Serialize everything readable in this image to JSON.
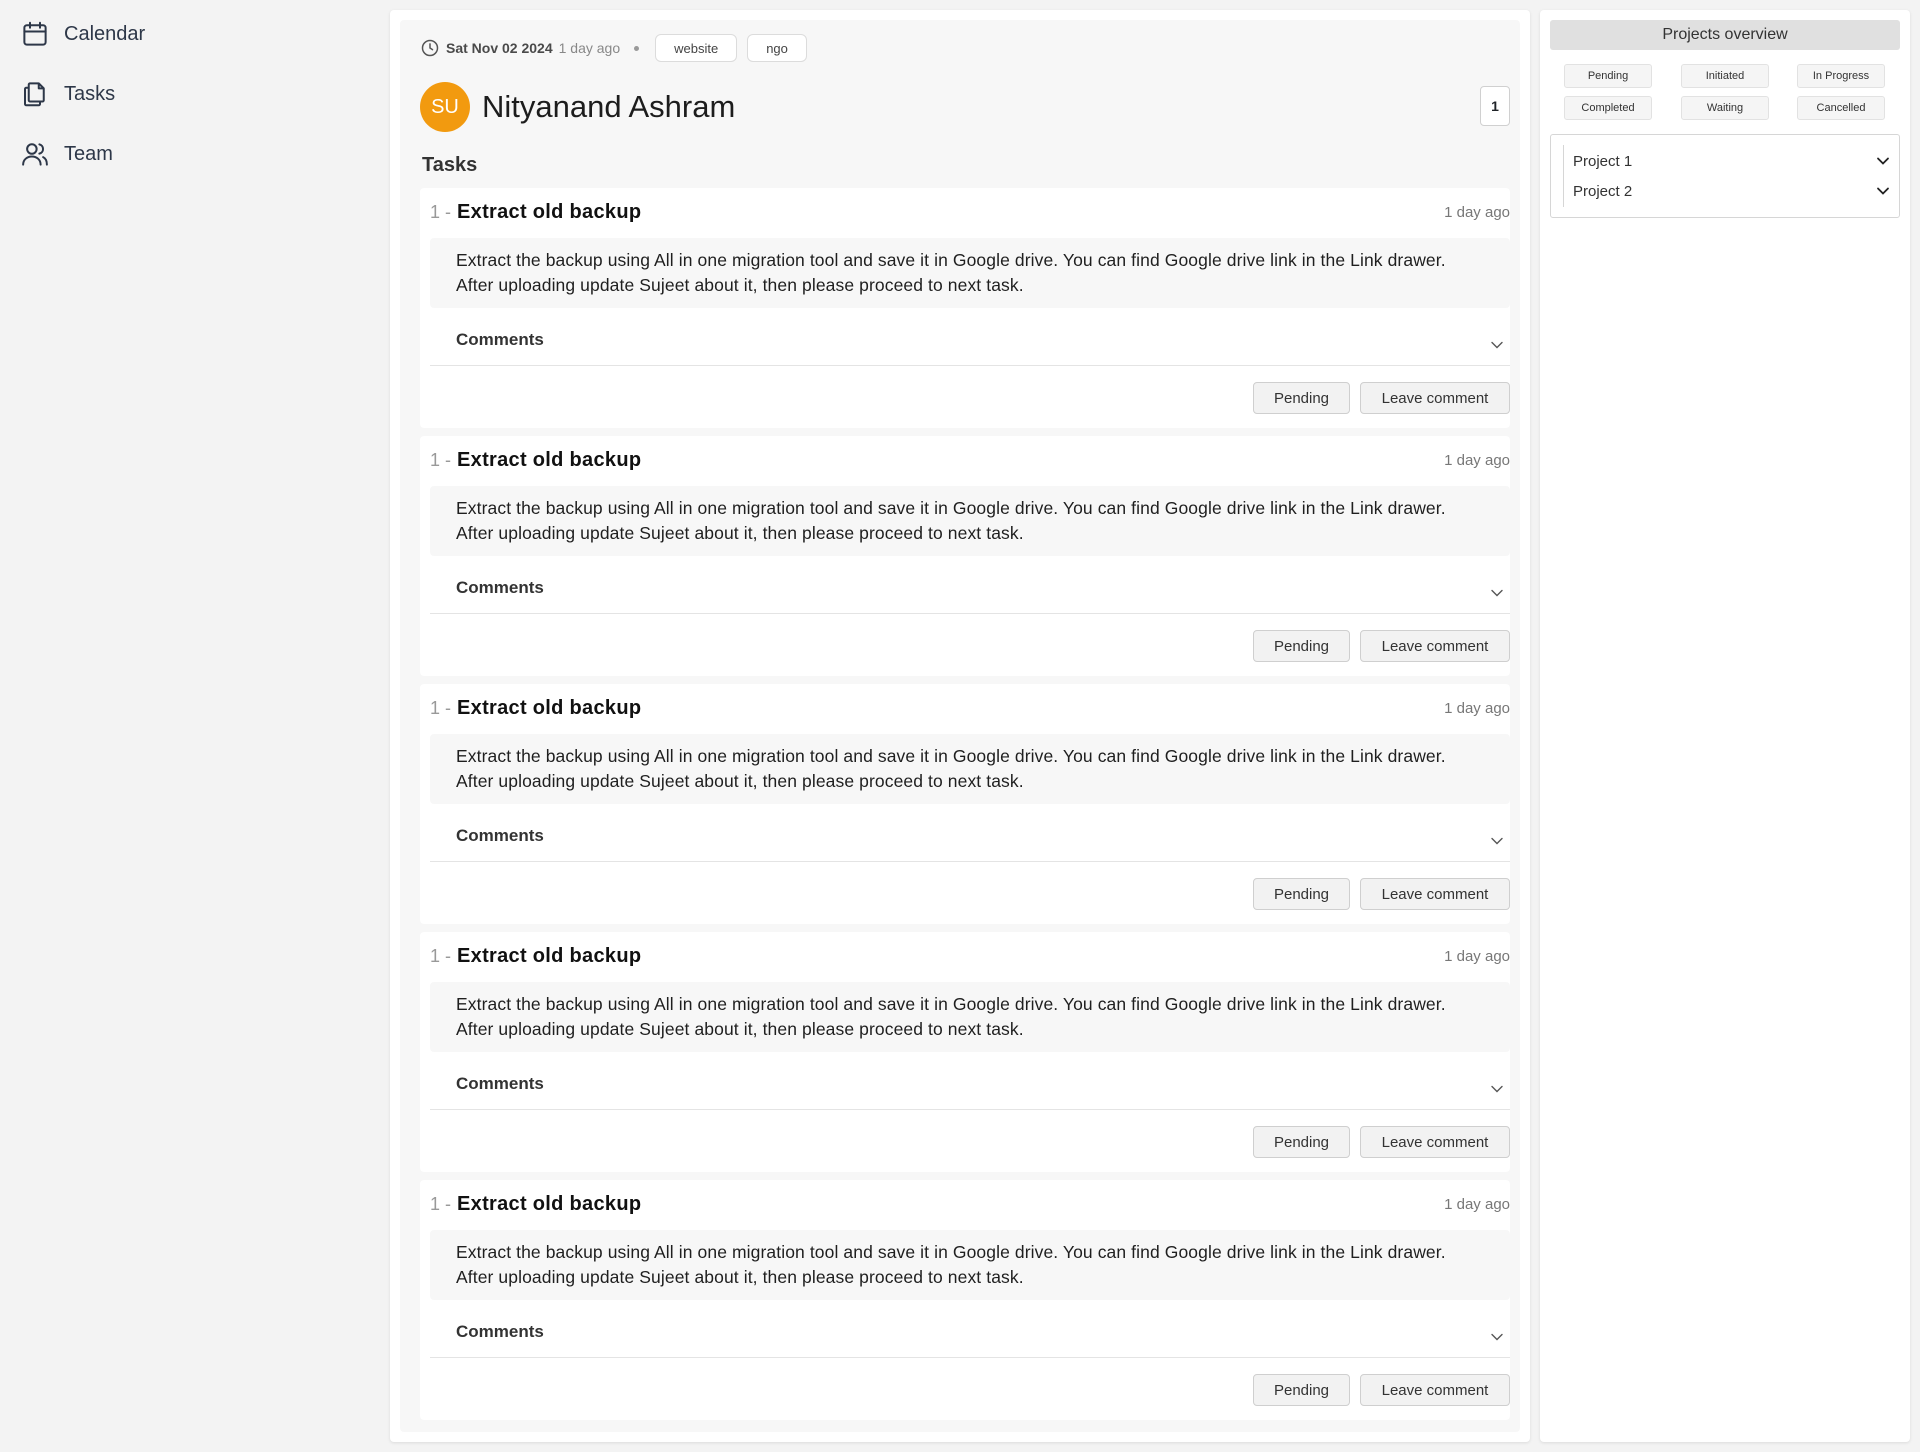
{
  "sidebar": {
    "items": [
      {
        "label": "Calendar",
        "icon": "calendar-icon"
      },
      {
        "label": "Tasks",
        "icon": "documents-icon"
      },
      {
        "label": "Team",
        "icon": "users-icon"
      }
    ]
  },
  "project": {
    "date": "Sat Nov 02 2024",
    "ago": "1 day ago",
    "tags": [
      "website",
      "ngo"
    ],
    "avatar_initials": "SU",
    "avatar_color": "#f29a0f",
    "name": "Nityanand Ashram",
    "count": "1"
  },
  "tasks_heading": "Tasks",
  "tasks": [
    {
      "number": "1 -",
      "title": "Extract old backup",
      "time": "1 day ago",
      "description_line1": "Extract the backup using All in one migration tool and save it in Google drive. You can find Google drive link in the Link drawer.",
      "description_line2": "After uploading update Sujeet about it, then please proceed to next task.",
      "comments_label": "Comments",
      "status_label": "Pending",
      "comment_button": "Leave comment"
    },
    {
      "number": "1 -",
      "title": "Extract old backup",
      "time": "1 day ago",
      "description_line1": "Extract the backup using All in one migration tool and save it in Google drive. You can find Google drive link in the Link drawer.",
      "description_line2": "After uploading update Sujeet about it, then please proceed to next task.",
      "comments_label": "Comments",
      "status_label": "Pending",
      "comment_button": "Leave comment"
    },
    {
      "number": "1 -",
      "title": "Extract old backup",
      "time": "1 day ago",
      "description_line1": "Extract the backup using All in one migration tool and save it in Google drive. You can find Google drive link in the Link drawer.",
      "description_line2": "After uploading update Sujeet about it, then please proceed to next task.",
      "comments_label": "Comments",
      "status_label": "Pending",
      "comment_button": "Leave comment"
    },
    {
      "number": "1 -",
      "title": "Extract old backup",
      "time": "1 day ago",
      "description_line1": "Extract the backup using All in one migration tool and save it in Google drive. You can find Google drive link in the Link drawer.",
      "description_line2": "After uploading update Sujeet about it, then please proceed to next task.",
      "comments_label": "Comments",
      "status_label": "Pending",
      "comment_button": "Leave comment"
    },
    {
      "number": "1 -",
      "title": "Extract old backup",
      "time": "1 day ago",
      "description_line1": "Extract the backup using All in one migration tool and save it in Google drive. You can find Google drive link in the Link drawer.",
      "description_line2": "After uploading update Sujeet about it, then please proceed to next task.",
      "comments_label": "Comments",
      "status_label": "Pending",
      "comment_button": "Leave comment"
    }
  ],
  "overview": {
    "title": "Projects overview",
    "statuses": [
      "Pending",
      "Initiated",
      "In Progress",
      "Completed",
      "Waiting",
      "Cancelled"
    ],
    "projects": [
      "Project 1",
      "Project 2"
    ]
  }
}
